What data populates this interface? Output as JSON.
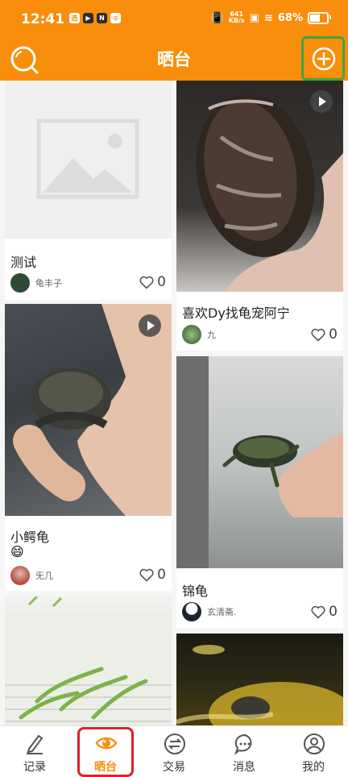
{
  "status_bar": {
    "time": "12:41",
    "net_speed_value": "641",
    "net_speed_unit": "KB/s",
    "battery": "68%",
    "battery_level": 0.68
  },
  "header": {
    "title": "晒台",
    "search_icon": "search-icon",
    "add_icon": "plus-circle-icon"
  },
  "feed": {
    "left": [
      {
        "caption": "测试",
        "emoji": "",
        "author": "龟丰子",
        "likes": "0",
        "has_video": false
      },
      {
        "caption": "小鳄龟",
        "emoji": "😄",
        "author": "旡几",
        "likes": "0",
        "has_video": true
      },
      {
        "caption": "",
        "emoji": "",
        "author": "",
        "likes": "",
        "has_video": false
      }
    ],
    "right": [
      {
        "caption": "喜欢Dy找龟宠阿宁",
        "emoji": "",
        "author": "九",
        "likes": "0",
        "has_video": true
      },
      {
        "caption": "锦龟",
        "emoji": "",
        "author": "玄清斋.",
        "likes": "0",
        "has_video": false
      },
      {
        "caption": "",
        "emoji": "",
        "author": "",
        "likes": "",
        "has_video": false
      }
    ]
  },
  "bottom_nav": {
    "items": [
      {
        "label": "记录",
        "icon": "pen-icon"
      },
      {
        "label": "晒台",
        "icon": "eye-icon",
        "active": true
      },
      {
        "label": "交易",
        "icon": "exchange-icon"
      },
      {
        "label": "消息",
        "icon": "chat-bubble-icon"
      },
      {
        "label": "我的",
        "icon": "user-icon"
      }
    ]
  },
  "colors": {
    "brand": "#f98e0c",
    "highlight_add": "#3ea63e",
    "highlight_tab": "#e0202b"
  }
}
